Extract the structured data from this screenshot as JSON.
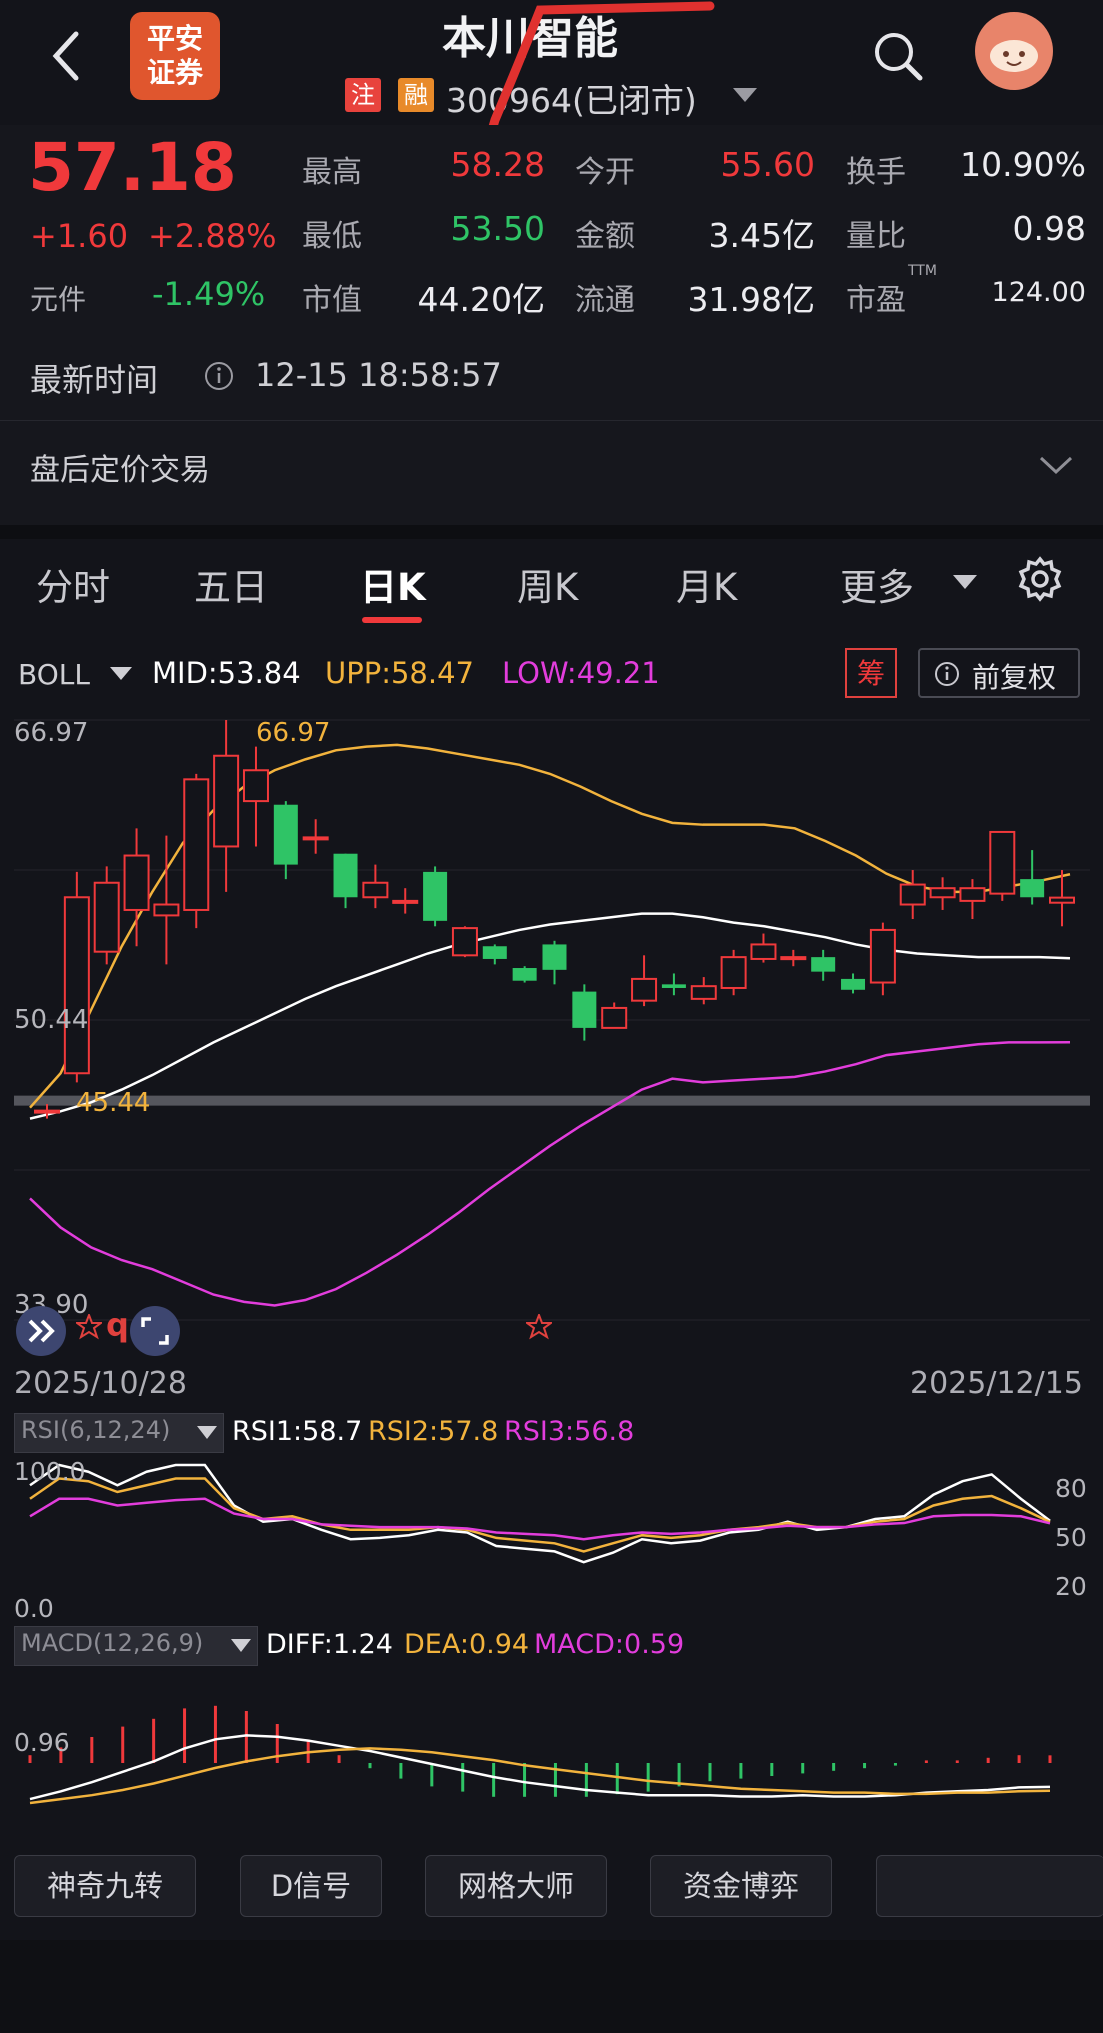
{
  "header": {
    "broker_logo": "平安\n证券",
    "broker_logo_line1": "平安",
    "broker_logo_line2": "证券",
    "stock_name": "本川智能",
    "badge_zhu": "注",
    "badge_rong": "融",
    "stock_code_status": "300964(已闭市)"
  },
  "quote": {
    "price": "57.18",
    "change": "+1.60",
    "change_pct": "+2.88%",
    "yuanjian_label": "元件",
    "yuanjian_value": "-1.49%",
    "stats": [
      {
        "label": "最高",
        "value": "58.28"
      },
      {
        "label": "今开",
        "value": "55.60"
      },
      {
        "label": "换手",
        "value": "10.90%"
      },
      {
        "label": "最低",
        "value": "53.50"
      },
      {
        "label": "金额",
        "value": "3.45亿"
      },
      {
        "label": "量比",
        "value": "0.98"
      },
      {
        "label": "市值",
        "value": "44.20亿"
      },
      {
        "label": "流通",
        "value": "31.98亿"
      },
      {
        "label": "市盈",
        "value": "124.00"
      }
    ],
    "pe_suffix": "TTM",
    "latest_time_label": "最新时间",
    "latest_time_value": "12-15 18:58:57",
    "after_hours_label": "盘后定价交易"
  },
  "tabs": [
    "分时",
    "五日",
    "日K",
    "周K",
    "月K",
    "更多"
  ],
  "active_tab": "日K",
  "boll": {
    "indicator": "BOLL",
    "mid": "MID:53.84",
    "upp": "UPP:58.47",
    "low": "LOW:49.21",
    "chip_button": "筹",
    "adjust_button": "前复权"
  },
  "chart_labels": {
    "y_top": "66.97",
    "y_mid": "50.44",
    "y_bottom": "33.90",
    "high_marker": "66.97",
    "low_marker": "45.44",
    "date_start": "2025/10/28",
    "date_end": "2025/12/15"
  },
  "rsi": {
    "indicator": "RSI(6,12,24)",
    "rsi1": "RSI1:58.7",
    "rsi2": "RSI2:57.8",
    "rsi3": "RSI3:56.8",
    "y_top": "100.0",
    "y_bottom": "0.0",
    "ticks": [
      "80",
      "50",
      "20"
    ]
  },
  "macd": {
    "indicator": "MACD(12,26,9)",
    "diff": "DIFF:1.24",
    "dea": "DEA:0.94",
    "macd": "MACD:0.59",
    "y_label": "0.96"
  },
  "buttons": [
    "神奇九转",
    "D信号",
    "网格大师",
    "资金博弈"
  ],
  "colors": {
    "up": "#f0393b",
    "down": "#2fc466",
    "upp": "#f2b33d",
    "low": "#e23ddc",
    "mid": "#ffffff",
    "bg": "#13141a"
  },
  "chart_data": [
    {
      "type": "candlestick",
      "title": "BOLL",
      "x_range": [
        "2025/10/28",
        "2025/12/15"
      ],
      "ylim": [
        33.9,
        66.97
      ],
      "candles": [
        {
          "o": 45.44,
          "h": 45.8,
          "l": 45.0,
          "c": 45.44
        },
        {
          "o": 47.5,
          "h": 58.6,
          "l": 47.0,
          "c": 57.2
        },
        {
          "o": 54.2,
          "h": 58.9,
          "l": 53.5,
          "c": 58.0
        },
        {
          "o": 56.5,
          "h": 61.0,
          "l": 54.5,
          "c": 59.5
        },
        {
          "o": 56.2,
          "h": 60.6,
          "l": 53.5,
          "c": 56.8
        },
        {
          "o": 56.5,
          "h": 64.0,
          "l": 55.5,
          "c": 63.7
        },
        {
          "o": 60.0,
          "h": 66.97,
          "l": 57.5,
          "c": 65.0
        },
        {
          "o": 62.5,
          "h": 65.5,
          "l": 60.0,
          "c": 64.2
        },
        {
          "o": 62.3,
          "h": 62.5,
          "l": 58.2,
          "c": 59.0
        },
        {
          "o": 60.5,
          "h": 61.5,
          "l": 59.6,
          "c": 60.5
        },
        {
          "o": 59.6,
          "h": 59.6,
          "l": 56.6,
          "c": 57.2
        },
        {
          "o": 57.2,
          "h": 59.0,
          "l": 56.6,
          "c": 58.0
        },
        {
          "o": 57.0,
          "h": 57.7,
          "l": 56.3,
          "c": 57.0
        },
        {
          "o": 58.6,
          "h": 58.9,
          "l": 55.6,
          "c": 55.9
        },
        {
          "o": 54.0,
          "h": 55.6,
          "l": 53.9,
          "c": 55.5
        },
        {
          "o": 54.5,
          "h": 54.6,
          "l": 53.5,
          "c": 53.8
        },
        {
          "o": 53.3,
          "h": 53.4,
          "l": 52.5,
          "c": 52.6
        },
        {
          "o": 54.6,
          "h": 54.8,
          "l": 52.4,
          "c": 53.2
        },
        {
          "o": 52.0,
          "h": 52.4,
          "l": 49.3,
          "c": 50.0
        },
        {
          "o": 50.0,
          "h": 51.4,
          "l": 50.0,
          "c": 51.1
        },
        {
          "o": 51.5,
          "h": 54.0,
          "l": 51.2,
          "c": 52.7
        },
        {
          "o": 52.4,
          "h": 53.0,
          "l": 51.8,
          "c": 52.2
        },
        {
          "o": 51.6,
          "h": 52.8,
          "l": 51.3,
          "c": 52.3
        },
        {
          "o": 52.2,
          "h": 54.3,
          "l": 51.8,
          "c": 53.9
        },
        {
          "o": 53.8,
          "h": 55.2,
          "l": 53.6,
          "c": 54.6
        },
        {
          "o": 53.9,
          "h": 54.3,
          "l": 53.4,
          "c": 53.9
        },
        {
          "o": 53.9,
          "h": 54.3,
          "l": 52.6,
          "c": 53.1
        },
        {
          "o": 52.7,
          "h": 53.0,
          "l": 51.9,
          "c": 52.1
        },
        {
          "o": 52.5,
          "h": 55.8,
          "l": 51.8,
          "c": 55.4
        },
        {
          "o": 56.8,
          "h": 58.7,
          "l": 56.0,
          "c": 57.9
        },
        {
          "o": 57.2,
          "h": 58.3,
          "l": 56.5,
          "c": 57.7
        },
        {
          "o": 57.0,
          "h": 58.2,
          "l": 56.0,
          "c": 57.7
        },
        {
          "o": 57.4,
          "h": 60.8,
          "l": 57.0,
          "c": 60.8
        },
        {
          "o": 58.2,
          "h": 59.8,
          "l": 56.8,
          "c": 57.2
        },
        {
          "o": 56.9,
          "h": 58.7,
          "l": 55.6,
          "c": 57.18
        }
      ],
      "series": [
        {
          "name": "UPP",
          "values": [
            45.6,
            47.5,
            51.0,
            54.5,
            57.5,
            60.2,
            62.0,
            63.3,
            64.2,
            64.8,
            65.3,
            65.5,
            65.6,
            65.4,
            65.1,
            64.8,
            64.5,
            64.0,
            63.3,
            62.5,
            61.8,
            61.3,
            61.2,
            61.2,
            61.2,
            61.0,
            60.3,
            59.5,
            58.5,
            57.8,
            57.5,
            57.5,
            57.8,
            58.1,
            58.47
          ]
        },
        {
          "name": "MID",
          "values": [
            45.0,
            45.4,
            45.9,
            46.6,
            47.4,
            48.3,
            49.2,
            50.0,
            50.8,
            51.6,
            52.3,
            52.9,
            53.5,
            54.1,
            54.6,
            55.0,
            55.4,
            55.7,
            55.9,
            56.1,
            56.3,
            56.3,
            56.1,
            55.8,
            55.6,
            55.3,
            55.0,
            54.6,
            54.3,
            54.1,
            54.0,
            53.9,
            53.9,
            53.9,
            53.84
          ]
        },
        {
          "name": "LOW",
          "values": [
            40.6,
            39.0,
            37.9,
            37.2,
            36.7,
            36.0,
            35.3,
            34.9,
            34.7,
            35.0,
            35.6,
            36.5,
            37.5,
            38.6,
            39.8,
            41.1,
            42.3,
            43.5,
            44.6,
            45.6,
            46.6,
            47.2,
            47.0,
            47.1,
            47.2,
            47.3,
            47.6,
            48.0,
            48.5,
            48.7,
            48.9,
            49.1,
            49.2,
            49.2,
            49.21
          ]
        }
      ]
    },
    {
      "type": "line",
      "title": "RSI(6,12,24)",
      "ylim": [
        0,
        100
      ],
      "series": [
        {
          "name": "RSI1",
          "values": [
            85,
            100,
            95,
            85,
            95,
            100,
            100,
            70,
            58,
            60,
            52,
            45,
            46,
            48,
            52,
            50,
            40,
            38,
            36,
            28,
            35,
            45,
            42,
            44,
            50,
            52,
            58,
            52,
            54,
            60,
            62,
            78,
            88,
            93,
            75,
            58.7
          ]
        },
        {
          "name": "RSI2",
          "values": [
            75,
            90,
            88,
            80,
            85,
            90,
            90,
            68,
            60,
            62,
            56,
            52,
            52,
            52,
            54,
            52,
            46,
            44,
            42,
            36,
            42,
            48,
            46,
            48,
            52,
            54,
            57,
            54,
            54,
            58,
            60,
            70,
            75,
            77,
            68,
            57.8
          ]
        },
        {
          "name": "RSI3",
          "values": [
            62,
            75,
            75,
            70,
            72,
            74,
            75,
            64,
            60,
            60,
            56,
            55,
            54,
            54,
            54,
            53,
            50,
            49,
            48,
            45,
            48,
            50,
            49,
            50,
            52,
            53,
            55,
            54,
            54,
            56,
            57,
            62,
            63,
            63,
            62,
            56.8
          ]
        }
      ]
    },
    {
      "type": "bar",
      "title": "MACD(12,26,9)",
      "series": [
        {
          "name": "DIFF",
          "values": [
            0.3,
            0.9,
            1.6,
            2.4,
            3.2,
            4.2,
            4.9,
            5.2,
            5.1,
            4.8,
            4.4,
            4.0,
            3.5,
            3.0,
            2.5,
            2.0,
            1.6,
            1.3,
            1.0,
            0.8,
            0.6,
            0.6,
            0.6,
            0.5,
            0.5,
            0.6,
            0.5,
            0.5,
            0.6,
            0.8,
            0.9,
            1.0,
            1.2,
            1.24
          ]
        },
        {
          "name": "DEA",
          "values": [
            0.0,
            0.3,
            0.6,
            1.0,
            1.5,
            2.1,
            2.7,
            3.2,
            3.6,
            3.9,
            4.1,
            4.2,
            4.1,
            3.9,
            3.6,
            3.3,
            2.9,
            2.6,
            2.3,
            2.0,
            1.7,
            1.5,
            1.3,
            1.1,
            1.0,
            0.9,
            0.8,
            0.8,
            0.7,
            0.7,
            0.8,
            0.8,
            0.9,
            0.94
          ]
        },
        {
          "name": "MACD",
          "values": [
            0.6,
            1.2,
            2.0,
            2.8,
            3.4,
            4.2,
            4.4,
            4.0,
            3.0,
            1.8,
            0.6,
            -0.4,
            -1.2,
            -1.8,
            -2.2,
            -2.6,
            -2.6,
            -2.6,
            -2.6,
            -2.4,
            -2.2,
            -1.8,
            -1.4,
            -1.2,
            -1.0,
            -0.8,
            -0.6,
            -0.4,
            -0.2,
            0.2,
            0.2,
            0.4,
            0.6,
            0.59
          ]
        }
      ]
    }
  ]
}
